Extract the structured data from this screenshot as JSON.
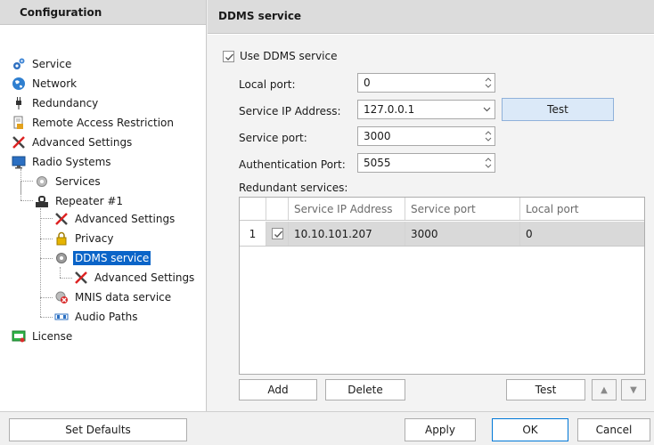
{
  "left": {
    "header": "Configuration",
    "tree": [
      {
        "label": "Service"
      },
      {
        "label": "Network"
      },
      {
        "label": "Redundancy"
      },
      {
        "label": "Remote Access Restriction"
      },
      {
        "label": "Advanced Settings"
      },
      {
        "label": "Radio Systems"
      },
      {
        "label": "Services"
      },
      {
        "label": "Repeater #1"
      },
      {
        "label": "Advanced Settings"
      },
      {
        "label": "Privacy"
      },
      {
        "label": "DDMS service"
      },
      {
        "label": "Advanced Settings"
      },
      {
        "label": "MNIS data service"
      },
      {
        "label": "Audio Paths"
      },
      {
        "label": "License"
      }
    ]
  },
  "right": {
    "header": "DDMS service",
    "use_ddms_label": "Use DDMS service",
    "local_port_label": "Local port:",
    "local_port_value": "0",
    "service_ip_label": "Service IP Address:",
    "service_ip_value": "127.0.0.1",
    "test_label": "Test",
    "service_port_label": "Service port:",
    "service_port_value": "3000",
    "auth_port_label": "Authentication Port:",
    "auth_port_value": "5055",
    "redundant_label": "Redundant services:",
    "grid": {
      "columns": [
        "Service IP Address",
        "Service port",
        "Local port"
      ],
      "rows": [
        {
          "num": "1",
          "ip": "10.10.101.207",
          "service_port": "3000",
          "local_port": "0"
        }
      ]
    },
    "add_label": "Add",
    "delete_label": "Delete",
    "test_bottom_label": "Test",
    "up_arrow": "▲",
    "down_arrow": "▼"
  },
  "bottom": {
    "set_defaults": "Set Defaults",
    "apply": "Apply",
    "ok": "OK",
    "cancel": "Cancel"
  },
  "colors": {
    "selection": "#0a64c8",
    "header_bg": "#dcdcdc",
    "test_button_bg": "#dbe9f8"
  }
}
